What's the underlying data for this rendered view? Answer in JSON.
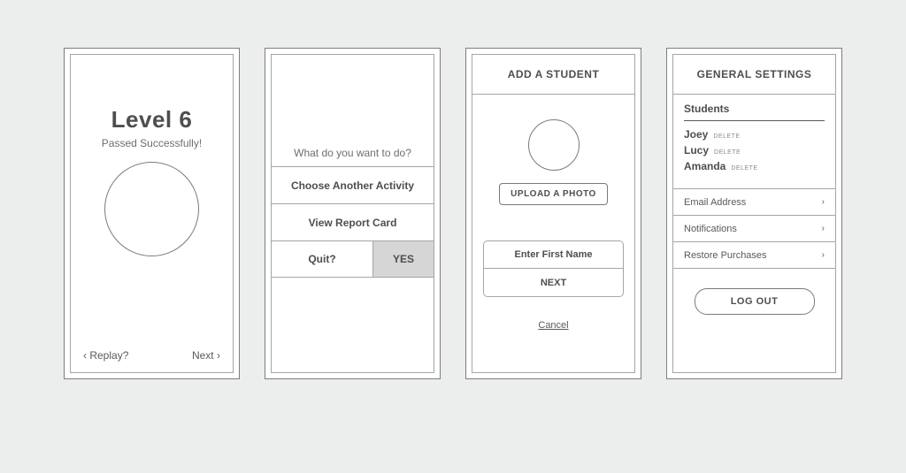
{
  "screen1": {
    "title": "Level 6",
    "subtitle": "Passed Successfully!",
    "replay_label": "Replay?",
    "next_label": "Next"
  },
  "screen2": {
    "prompt": "What do you want to do?",
    "choose_activity_label": "Choose Another Activity",
    "view_report_label": "View Report Card",
    "quit_label": "Quit?",
    "yes_label": "YES"
  },
  "screen3": {
    "title": "ADD A STUDENT",
    "upload_label": "UPLOAD A PHOTO",
    "first_name_placeholder": "Enter First Name",
    "next_label": "NEXT",
    "cancel_label": "Cancel"
  },
  "screen4": {
    "title": "GENERAL SETTINGS",
    "students_section_label": "Students",
    "students": [
      {
        "name": "Joey",
        "delete_label": "DELETE"
      },
      {
        "name": "Lucy",
        "delete_label": "DELETE"
      },
      {
        "name": "Amanda",
        "delete_label": "DELETE"
      }
    ],
    "menu": {
      "email_label": "Email Address",
      "notifications_label": "Notifications",
      "restore_label": "Restore Purchases"
    },
    "logout_label": "LOG OUT"
  }
}
